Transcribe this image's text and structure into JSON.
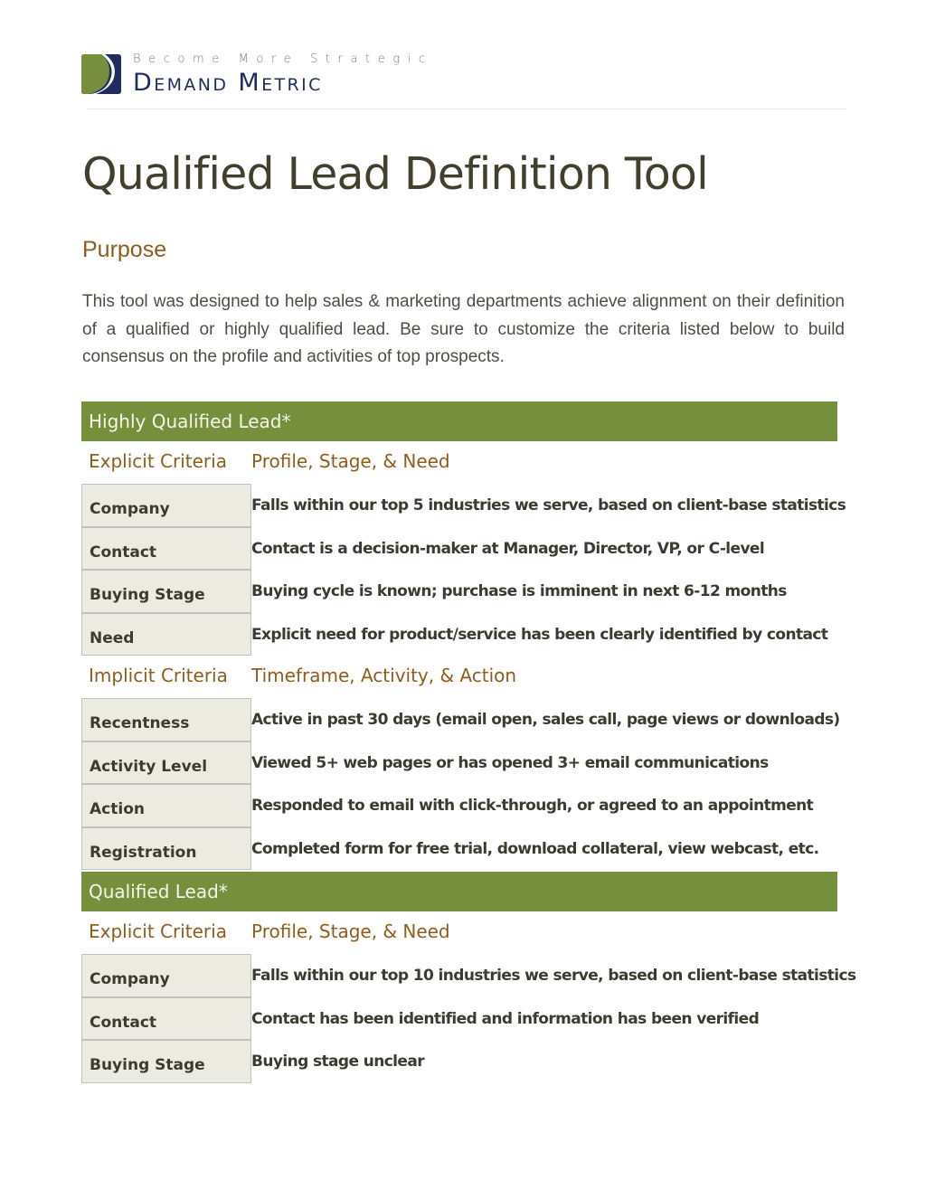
{
  "header": {
    "tagline": "Become More Strategic",
    "brand_first": "Demand",
    "brand_second": "Metric",
    "logo_colors": {
      "green": "#778f3d",
      "navy": "#1f2d5e"
    }
  },
  "title": "Qualified Lead Definition Tool",
  "purpose": {
    "heading": "Purpose",
    "body": "This tool was designed to help sales & marketing departments achieve alignment on their definition of a qualified or highly qualified lead.  Be sure to customize the criteria listed below to build consensus on the profile and activities of top prospects."
  },
  "colors": {
    "band": "#758f3c",
    "accent": "#8d5d1c",
    "label_bg": "#ecebe2"
  },
  "sections": [
    {
      "title": "Highly Qualified Lead*",
      "groups": [
        {
          "criteria": "Explicit Criteria",
          "heading": "Profile, Stage, & Need",
          "rows": [
            {
              "label": "Company",
              "value": "Falls within our top 5 industries we serve, based on client-base statistics"
            },
            {
              "label": "Contact",
              "value": "Contact is a decision-maker at Manager, Director, VP, or C-level"
            },
            {
              "label": "Buying Stage",
              "value": "Buying cycle is known; purchase is imminent in next 6-12 months"
            },
            {
              "label": "Need",
              "value": "Explicit need for product/service has been clearly identified by contact"
            }
          ]
        },
        {
          "criteria": "Implicit Criteria",
          "heading": "Timeframe, Activity, & Action",
          "rows": [
            {
              "label": "Recentness",
              "value": "Active in past 30 days (email open, sales call,  page views or downloads)"
            },
            {
              "label": "Activity Level",
              "value": "Viewed 5+ web pages or has opened 3+ email communications"
            },
            {
              "label": "Action",
              "value": "Responded to email with click-through, or agreed to an appointment"
            },
            {
              "label": "Registration",
              "value": "Completed form for free trial, download collateral, view webcast, etc."
            }
          ]
        }
      ]
    },
    {
      "title": "Qualified Lead*",
      "groups": [
        {
          "criteria": "Explicit Criteria",
          "heading": "Profile, Stage, & Need",
          "rows": [
            {
              "label": "Company",
              "value": "Falls within our top 10 industries we serve, based on client-base statistics"
            },
            {
              "label": "Contact",
              "value": "Contact has been identified and information has been verified"
            },
            {
              "label": "Buying Stage",
              "value": "Buying stage unclear"
            }
          ]
        }
      ]
    }
  ]
}
